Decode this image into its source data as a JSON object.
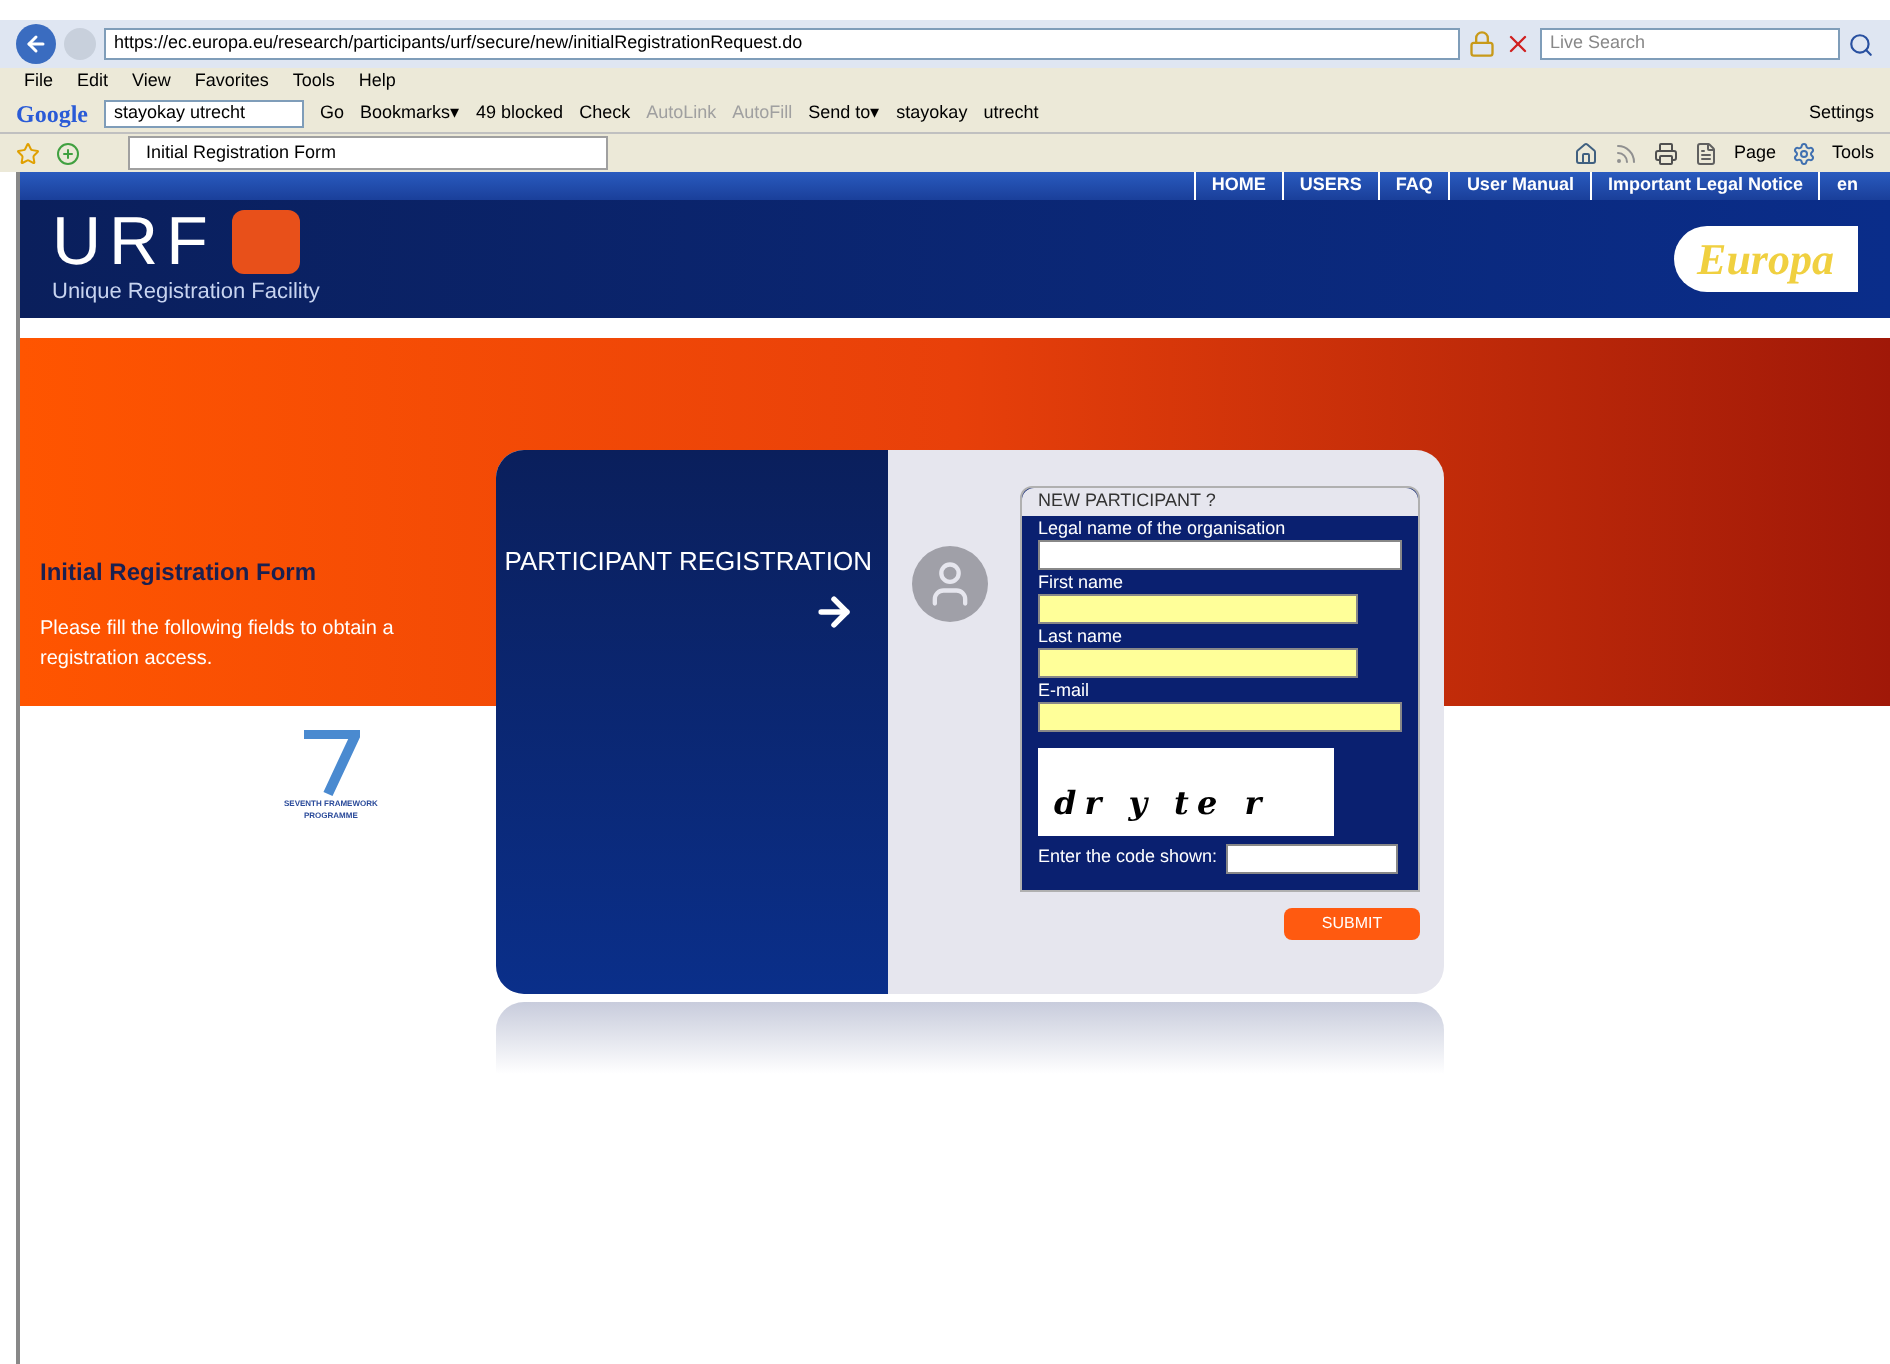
{
  "browser": {
    "address": "https://ec.europa.eu/research/participants/urf/secure/new/initialRegistrationRequest.do",
    "search_placeholder": "Live Search",
    "menu": [
      "File",
      "Edit",
      "View",
      "Favorites",
      "Tools",
      "Help"
    ],
    "google_toolbar": {
      "logo": "Google",
      "query": "stayokay utrecht",
      "items": [
        {
          "label": "Go",
          "disabled": false
        },
        {
          "label": "Bookmarks▾",
          "disabled": false
        },
        {
          "label": "49 blocked",
          "disabled": false
        },
        {
          "label": "Check",
          "disabled": false
        },
        {
          "label": "AutoLink",
          "disabled": true
        },
        {
          "label": "AutoFill",
          "disabled": true
        },
        {
          "label": "Send to▾",
          "disabled": false
        },
        {
          "label": "stayokay",
          "disabled": false
        },
        {
          "label": "utrecht",
          "disabled": false
        }
      ],
      "settings": "Settings"
    },
    "tab": {
      "title": "Initial Registration Form"
    },
    "command_bar": [
      "Page",
      "Tools"
    ]
  },
  "site": {
    "nav": [
      "HOME",
      "USERS",
      "FAQ",
      "User Manual",
      "Important Legal Notice",
      "en"
    ],
    "logo": "URF",
    "subtitle": "Unique Registration Facility",
    "europa_logo": "Europa",
    "intro": {
      "title": "Initial Registration Form",
      "text": "Please fill the following fields to obtain a registration access."
    },
    "fp7_logo": {
      "line_1": "SEVENTH FRAMEWORK",
      "line_2": "PROGRAMME"
    },
    "card": {
      "heading": "PARTICIPANT REGISTRATION",
      "form_title": "NEW PARTICIPANT ?",
      "fields": [
        {
          "label": "Legal name of the organisation",
          "required": false,
          "wide": true
        },
        {
          "label": "First name",
          "required": true,
          "wide": false
        },
        {
          "label": "Last name",
          "required": true,
          "wide": false
        },
        {
          "label": "E-mail",
          "required": true,
          "wide": true
        }
      ],
      "captcha": "dr y te r",
      "code_label": "Enter the code shown:",
      "submit": "SUBMIT"
    }
  }
}
